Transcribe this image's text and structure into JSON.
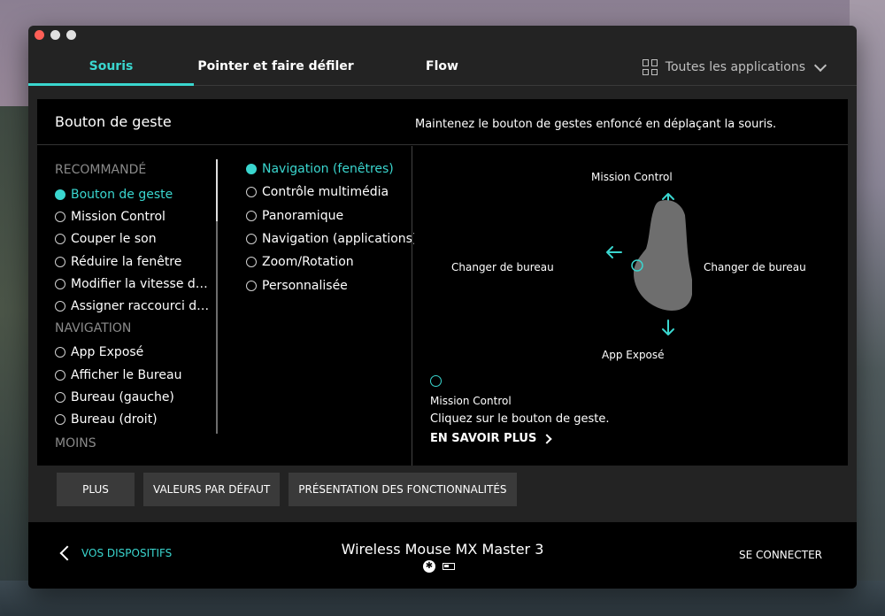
{
  "tabs": [
    {
      "label": "Souris",
      "active": true
    },
    {
      "label": "Pointer et faire défiler",
      "active": false
    },
    {
      "label": "Flow",
      "active": false
    }
  ],
  "apps_selector": {
    "label": "Toutes les applications",
    "icon": "grid-icon"
  },
  "panel": {
    "title": "Bouton de geste",
    "hint": "Maintenez le bouton de gestes enfoncé en déplaçant la souris."
  },
  "sidebar": {
    "sections": [
      {
        "title": "RECOMMANDÉ",
        "items": [
          {
            "label": "Bouton de geste",
            "selected": true
          },
          {
            "label": "Mission Control",
            "selected": false
          },
          {
            "label": "Couper le son",
            "selected": false
          },
          {
            "label": "Réduire la fenêtre",
            "selected": false
          },
          {
            "label": "Modifier la vitesse d…",
            "selected": false
          },
          {
            "label": "Assigner raccourci d…",
            "selected": false
          }
        ]
      },
      {
        "title": "NAVIGATION",
        "items": [
          {
            "label": "App Exposé",
            "selected": false
          },
          {
            "label": "Afficher le Bureau",
            "selected": false
          },
          {
            "label": "Bureau (gauche)",
            "selected": false
          },
          {
            "label": "Bureau (droit)",
            "selected": false
          }
        ]
      },
      {
        "title": "MOINS",
        "items": []
      }
    ]
  },
  "gesture_options": [
    {
      "label": "Navigation (fenêtres)",
      "selected": true
    },
    {
      "label": "Contrôle multimédia",
      "selected": false
    },
    {
      "label": "Panoramique",
      "selected": false
    },
    {
      "label": "Navigation (applications)",
      "selected": false
    },
    {
      "label": "Zoom/Rotation",
      "selected": false
    },
    {
      "label": "Personnalisée",
      "selected": false
    }
  ],
  "gesture": {
    "up": "Mission Control",
    "down": "App Exposé",
    "left": "Changer de bureau",
    "right": "Changer de bureau"
  },
  "hint": {
    "title": "Mission Control",
    "text": "Cliquez sur le bouton de geste.",
    "learn_more": "EN SAVOIR PLUS"
  },
  "buttons": {
    "plus": "PLUS",
    "defaults": "VALEURS PAR DÉFAUT",
    "features": "PRÉSENTATION DES FONCTIONNALITÉS"
  },
  "footer": {
    "back": "VOS DISPOSITIFS",
    "device_name": "Wireless Mouse MX Master 3",
    "connect": "SE CONNECTER"
  },
  "colors": {
    "accent": "#3ad6cf",
    "window_bg": "#232323",
    "panel_bg": "#000000"
  }
}
